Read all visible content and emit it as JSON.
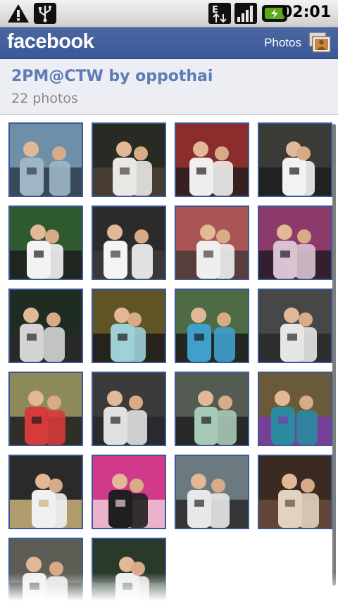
{
  "status_bar": {
    "time": "02:01",
    "icons": [
      "warning-icon",
      "usb-icon",
      "edge-data-icon",
      "signal-icon",
      "battery-charging-icon"
    ]
  },
  "app_header": {
    "logo": "facebook",
    "section_label": "Photos",
    "icons": [
      "photos-icon"
    ]
  },
  "album": {
    "title": "2PM@CTW by oppothai",
    "photo_count": "22 photos"
  },
  "photos": [
    {
      "index": 1
    },
    {
      "index": 2
    },
    {
      "index": 3
    },
    {
      "index": 4
    },
    {
      "index": 5
    },
    {
      "index": 6
    },
    {
      "index": 7
    },
    {
      "index": 8
    },
    {
      "index": 9
    },
    {
      "index": 10
    },
    {
      "index": 11
    },
    {
      "index": 12
    },
    {
      "index": 13
    },
    {
      "index": 14
    },
    {
      "index": 15
    },
    {
      "index": 16
    },
    {
      "index": 17
    },
    {
      "index": 18
    },
    {
      "index": 19
    },
    {
      "index": 20
    },
    {
      "index": 21
    },
    {
      "index": 22
    }
  ],
  "colors": {
    "facebook_blue": "#3b5998",
    "album_title": "#5d7bb6",
    "album_count": "#8a8a8a",
    "thumb_border": "#3b5998"
  }
}
